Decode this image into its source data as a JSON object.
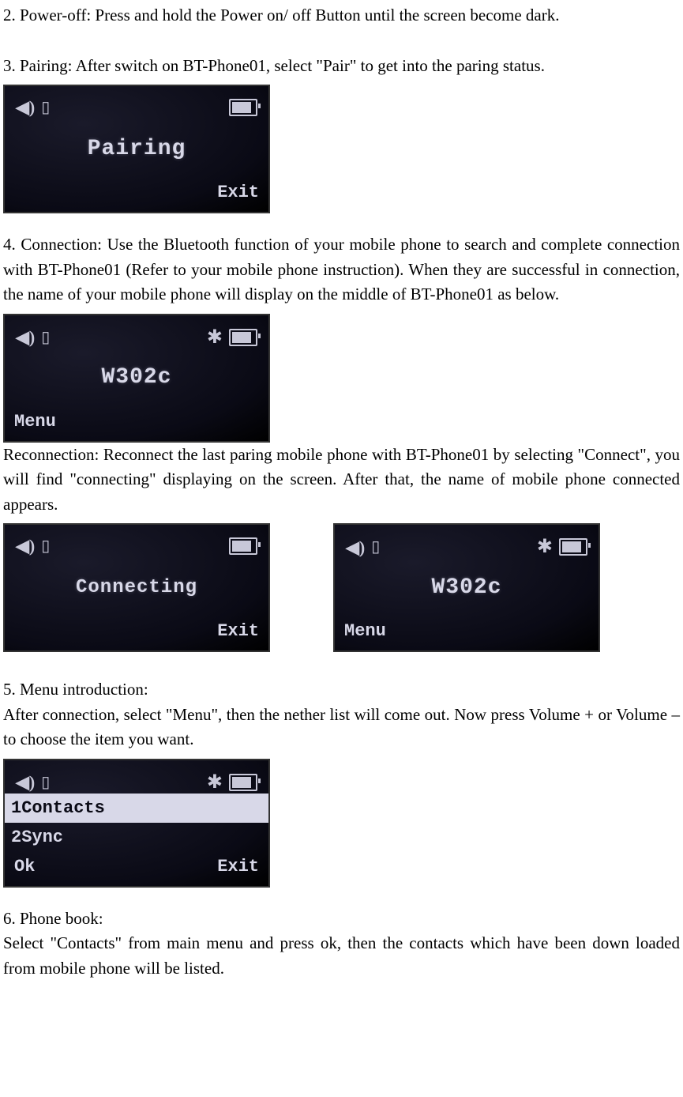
{
  "paragraphs": {
    "p2": "2. Power-off: Press and hold the Power on/ off Button until the screen become dark.",
    "p3": "3. Pairing: After switch on BT-Phone01, select \"Pair\" to get into the paring status.",
    "p4": "4. Connection: Use the Bluetooth function of your mobile phone to search and complete connection with BT-Phone01 (Refer to your mobile phone instruction). When they are successful in connection, the name of your mobile phone will display on the middle of BT-Phone01 as below.",
    "p4b": "Reconnection: Reconnect the last paring mobile phone with BT-Phone01 by selecting \"Connect\", you will find \"connecting\" displaying on the screen. After that, the name of mobile phone connected appears.",
    "p5a": "5. Menu introduction:",
    "p5b": "After connection, select \"Menu\", then the nether list will come out. Now press Volume + or Volume – to choose the item you want.",
    "p6a": "6. Phone book:",
    "p6b": "Select \"Contacts\" from main menu and press ok, then the contacts which have been down loaded from mobile phone will be listed."
  },
  "screens": {
    "pairing": {
      "center": "Pairing",
      "left_softkey": "",
      "right_softkey": "Exit",
      "show_bt": false
    },
    "connected": {
      "center": "W302c",
      "left_softkey": "Menu",
      "right_softkey": "",
      "show_bt": true
    },
    "connecting": {
      "center": "Connecting",
      "left_softkey": "",
      "right_softkey": "Exit",
      "show_bt": false
    },
    "connected2": {
      "center": "W302c",
      "left_softkey": "Menu",
      "right_softkey": "",
      "show_bt": true
    },
    "menu": {
      "items": [
        "1Contacts",
        "2Sync"
      ],
      "selected_index": 0,
      "left_softkey": "Ok",
      "right_softkey": "Exit",
      "show_bt": true
    }
  },
  "icons": {
    "speaker": "◀)",
    "phone": "☎",
    "bluetooth": "✱"
  }
}
